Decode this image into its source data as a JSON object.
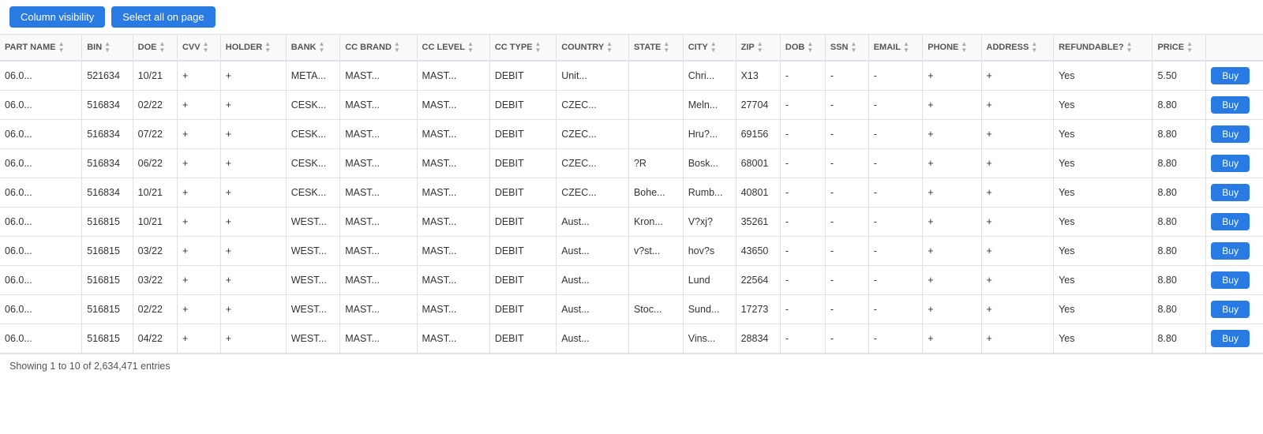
{
  "toolbar": {
    "column_visibility_label": "Column visibility",
    "select_all_label": "Select all on page"
  },
  "table": {
    "columns": [
      {
        "key": "part_name",
        "label": "PART NAME"
      },
      {
        "key": "bin",
        "label": "BIN"
      },
      {
        "key": "doe",
        "label": "DOE"
      },
      {
        "key": "cvv",
        "label": "CVV"
      },
      {
        "key": "holder",
        "label": "HOLDER"
      },
      {
        "key": "bank",
        "label": "BANK"
      },
      {
        "key": "cc_brand",
        "label": "CC BRAND"
      },
      {
        "key": "cc_level",
        "label": "CC LEVEL"
      },
      {
        "key": "cc_type",
        "label": "CC TYPE"
      },
      {
        "key": "country",
        "label": "COUNTRY"
      },
      {
        "key": "state",
        "label": "STATE"
      },
      {
        "key": "city",
        "label": "CITY"
      },
      {
        "key": "zip",
        "label": "ZIP"
      },
      {
        "key": "dob",
        "label": "DOB"
      },
      {
        "key": "ssn",
        "label": "SSN"
      },
      {
        "key": "email",
        "label": "EMAIL"
      },
      {
        "key": "phone",
        "label": "PHONE"
      },
      {
        "key": "address",
        "label": "ADDRESS"
      },
      {
        "key": "refundable",
        "label": "REFUNDABLE?"
      },
      {
        "key": "price",
        "label": "PRICE"
      },
      {
        "key": "action",
        "label": ""
      }
    ],
    "rows": [
      {
        "part_name": "06.0...",
        "bin": "521634",
        "doe": "10/21",
        "cvv": "+",
        "holder": "+",
        "bank": "META...",
        "cc_brand": "MAST...",
        "cc_level": "MAST...",
        "cc_type": "DEBIT",
        "country": "Unit...",
        "state": "",
        "city": "Chri...",
        "zip": "X13",
        "dob": "-",
        "ssn": "-",
        "email": "-",
        "phone": "+",
        "address": "+",
        "refundable": "Yes",
        "price": "5.50"
      },
      {
        "part_name": "06.0...",
        "bin": "516834",
        "doe": "02/22",
        "cvv": "+",
        "holder": "+",
        "bank": "CESK...",
        "cc_brand": "MAST...",
        "cc_level": "MAST...",
        "cc_type": "DEBIT",
        "country": "CZEC...",
        "state": "",
        "city": "Meln...",
        "zip": "27704",
        "dob": "-",
        "ssn": "-",
        "email": "-",
        "phone": "+",
        "address": "+",
        "refundable": "Yes",
        "price": "8.80"
      },
      {
        "part_name": "06.0...",
        "bin": "516834",
        "doe": "07/22",
        "cvv": "+",
        "holder": "+",
        "bank": "CESK...",
        "cc_brand": "MAST...",
        "cc_level": "MAST...",
        "cc_type": "DEBIT",
        "country": "CZEC...",
        "state": "",
        "city": "Hru?...",
        "zip": "69156",
        "dob": "-",
        "ssn": "-",
        "email": "-",
        "phone": "+",
        "address": "+",
        "refundable": "Yes",
        "price": "8.80"
      },
      {
        "part_name": "06.0...",
        "bin": "516834",
        "doe": "06/22",
        "cvv": "+",
        "holder": "+",
        "bank": "CESK...",
        "cc_brand": "MAST...",
        "cc_level": "MAST...",
        "cc_type": "DEBIT",
        "country": "CZEC...",
        "state": "?R",
        "city": "Bosk...",
        "zip": "68001",
        "dob": "-",
        "ssn": "-",
        "email": "-",
        "phone": "+",
        "address": "+",
        "refundable": "Yes",
        "price": "8.80"
      },
      {
        "part_name": "06.0...",
        "bin": "516834",
        "doe": "10/21",
        "cvv": "+",
        "holder": "+",
        "bank": "CESK...",
        "cc_brand": "MAST...",
        "cc_level": "MAST...",
        "cc_type": "DEBIT",
        "country": "CZEC...",
        "state": "Bohe...",
        "city": "Rumb...",
        "zip": "40801",
        "dob": "-",
        "ssn": "-",
        "email": "-",
        "phone": "+",
        "address": "+",
        "refundable": "Yes",
        "price": "8.80"
      },
      {
        "part_name": "06.0...",
        "bin": "516815",
        "doe": "10/21",
        "cvv": "+",
        "holder": "+",
        "bank": "WEST...",
        "cc_brand": "MAST...",
        "cc_level": "MAST...",
        "cc_type": "DEBIT",
        "country": "Aust...",
        "state": "Kron...",
        "city": "V?xj?",
        "zip": "35261",
        "dob": "-",
        "ssn": "-",
        "email": "-",
        "phone": "+",
        "address": "+",
        "refundable": "Yes",
        "price": "8.80"
      },
      {
        "part_name": "06.0...",
        "bin": "516815",
        "doe": "03/22",
        "cvv": "+",
        "holder": "+",
        "bank": "WEST...",
        "cc_brand": "MAST...",
        "cc_level": "MAST...",
        "cc_type": "DEBIT",
        "country": "Aust...",
        "state": "v?st...",
        "city": "hov?s",
        "zip": "43650",
        "dob": "-",
        "ssn": "-",
        "email": "-",
        "phone": "+",
        "address": "+",
        "refundable": "Yes",
        "price": "8.80"
      },
      {
        "part_name": "06.0...",
        "bin": "516815",
        "doe": "03/22",
        "cvv": "+",
        "holder": "+",
        "bank": "WEST...",
        "cc_brand": "MAST...",
        "cc_level": "MAST...",
        "cc_type": "DEBIT",
        "country": "Aust...",
        "state": "",
        "city": "Lund",
        "zip": "22564",
        "dob": "-",
        "ssn": "-",
        "email": "-",
        "phone": "+",
        "address": "+",
        "refundable": "Yes",
        "price": "8.80"
      },
      {
        "part_name": "06.0...",
        "bin": "516815",
        "doe": "02/22",
        "cvv": "+",
        "holder": "+",
        "bank": "WEST...",
        "cc_brand": "MAST...",
        "cc_level": "MAST...",
        "cc_type": "DEBIT",
        "country": "Aust...",
        "state": "Stoc...",
        "city": "Sund...",
        "zip": "17273",
        "dob": "-",
        "ssn": "-",
        "email": "-",
        "phone": "+",
        "address": "+",
        "refundable": "Yes",
        "price": "8.80"
      },
      {
        "part_name": "06.0...",
        "bin": "516815",
        "doe": "04/22",
        "cvv": "+",
        "holder": "+",
        "bank": "WEST...",
        "cc_brand": "MAST...",
        "cc_level": "MAST...",
        "cc_type": "DEBIT",
        "country": "Aust...",
        "state": "",
        "city": "Vins...",
        "zip": "28834",
        "dob": "-",
        "ssn": "-",
        "email": "-",
        "phone": "+",
        "address": "+",
        "refundable": "Yes",
        "price": "8.80"
      }
    ],
    "buy_label": "Buy"
  },
  "footer": {
    "text": "Showing 1 to 10 of 2,634,471 entries"
  }
}
